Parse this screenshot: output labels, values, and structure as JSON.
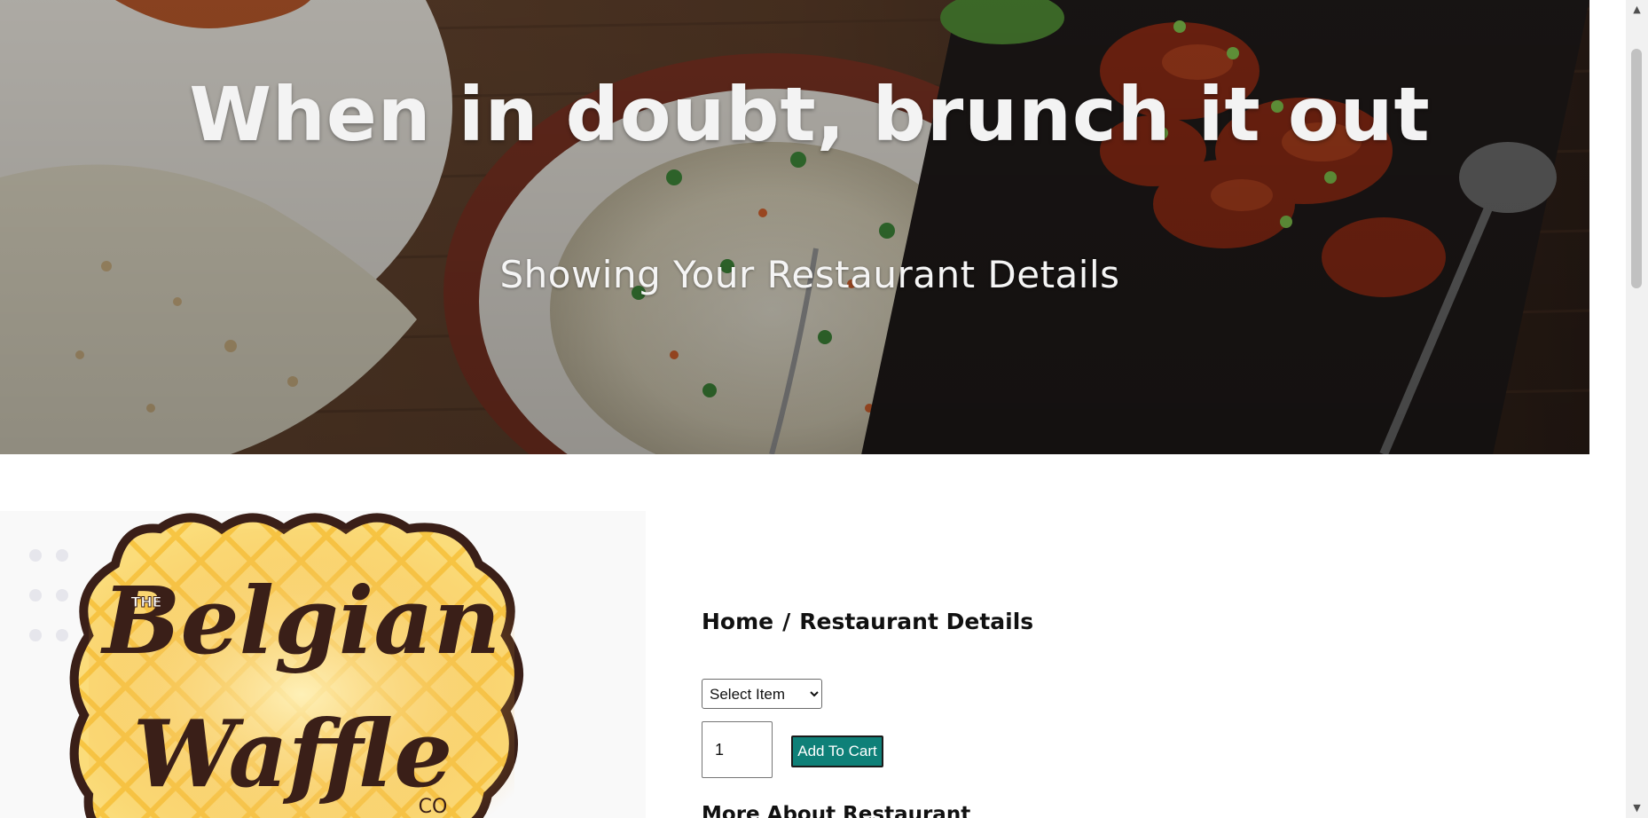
{
  "hero": {
    "title": "When in doubt, brunch it out",
    "subtitle": "Showing Your Restaurant Details"
  },
  "logo": {
    "alt": "The Belgian Waffle Co",
    "text_line1": "Belgian",
    "text_line2": "Waffle",
    "text_prefix": "THE",
    "text_suffix": "CO",
    "colors": {
      "waffle_yellow": "#f5b933",
      "waffle_light": "#fbd56a",
      "outline": "#3a1f18"
    }
  },
  "breadcrumb": {
    "home": "Home",
    "separator": "/",
    "current": "Restaurant Details"
  },
  "order": {
    "select_value": "Select Item",
    "options": [
      "Select Item"
    ],
    "quantity": "1",
    "add_to_cart_label": "Add To Cart",
    "button_color": "#0f8078"
  },
  "more": {
    "heading": "More About Restaurant"
  },
  "scrollbar": {
    "up_icon": "▲",
    "down_icon": "▼"
  }
}
